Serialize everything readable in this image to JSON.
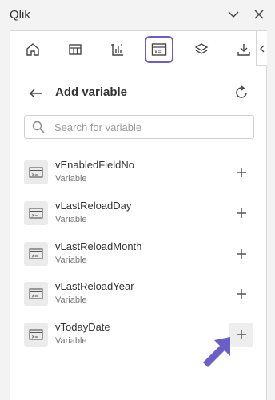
{
  "app": {
    "title": "Qlik"
  },
  "toolbar": {
    "buttons": [
      {
        "name": "home",
        "icon": "home-icon"
      },
      {
        "name": "table",
        "icon": "table-icon"
      },
      {
        "name": "chart",
        "icon": "bar-chart-icon"
      },
      {
        "name": "variable",
        "icon": "variable-icon",
        "active": true
      },
      {
        "name": "layers",
        "icon": "layers-icon"
      },
      {
        "name": "download",
        "icon": "download-icon"
      }
    ],
    "accent_color": "#6b5fc7"
  },
  "header": {
    "title": "Add variable"
  },
  "search": {
    "placeholder": "Search for variable",
    "value": ""
  },
  "variables": [
    {
      "name": "vEnabledFieldNo",
      "type": "Variable"
    },
    {
      "name": "vLastReloadDay",
      "type": "Variable"
    },
    {
      "name": "vLastReloadMonth",
      "type": "Variable"
    },
    {
      "name": "vLastReloadYear",
      "type": "Variable"
    },
    {
      "name": "vTodayDate",
      "type": "Variable"
    }
  ],
  "cursor": {
    "color": "#6b5fc7"
  }
}
